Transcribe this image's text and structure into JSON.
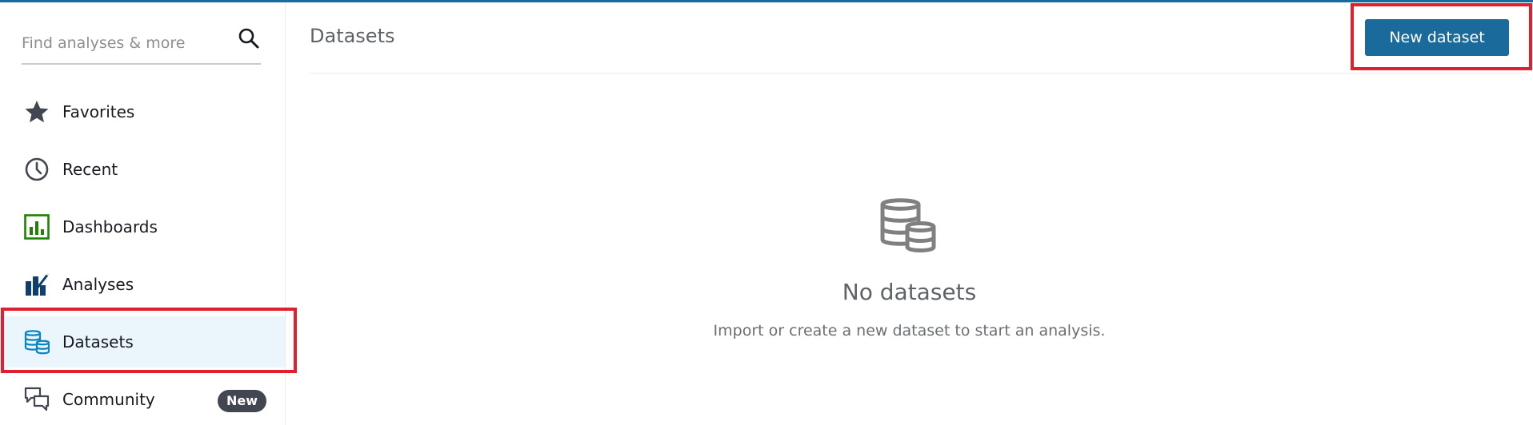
{
  "sidebar": {
    "search": {
      "placeholder": "Find analyses & more",
      "value": ""
    },
    "items": [
      {
        "label": "Favorites",
        "icon": "star-icon"
      },
      {
        "label": "Recent",
        "icon": "clock-icon"
      },
      {
        "label": "Dashboards",
        "icon": "dashboard-icon"
      },
      {
        "label": "Analyses",
        "icon": "analyses-icon"
      },
      {
        "label": "Datasets",
        "icon": "dataset-icon",
        "active": true
      },
      {
        "label": "Community",
        "icon": "community-icon",
        "badge": "New"
      }
    ]
  },
  "main": {
    "title": "Datasets",
    "new_button_label": "New dataset",
    "empty_state": {
      "icon": "dataset-empty-icon",
      "title": "No datasets",
      "description": "Import or create a new dataset to start an analysis."
    }
  },
  "colors": {
    "accent": "#1b6a9c",
    "highlight": "#e0202f",
    "active_bg": "#eaf6fb",
    "dashboard_green": "#1d8102",
    "analyses_navy": "#0f3f6e",
    "dataset_blue": "#0a84c6"
  }
}
